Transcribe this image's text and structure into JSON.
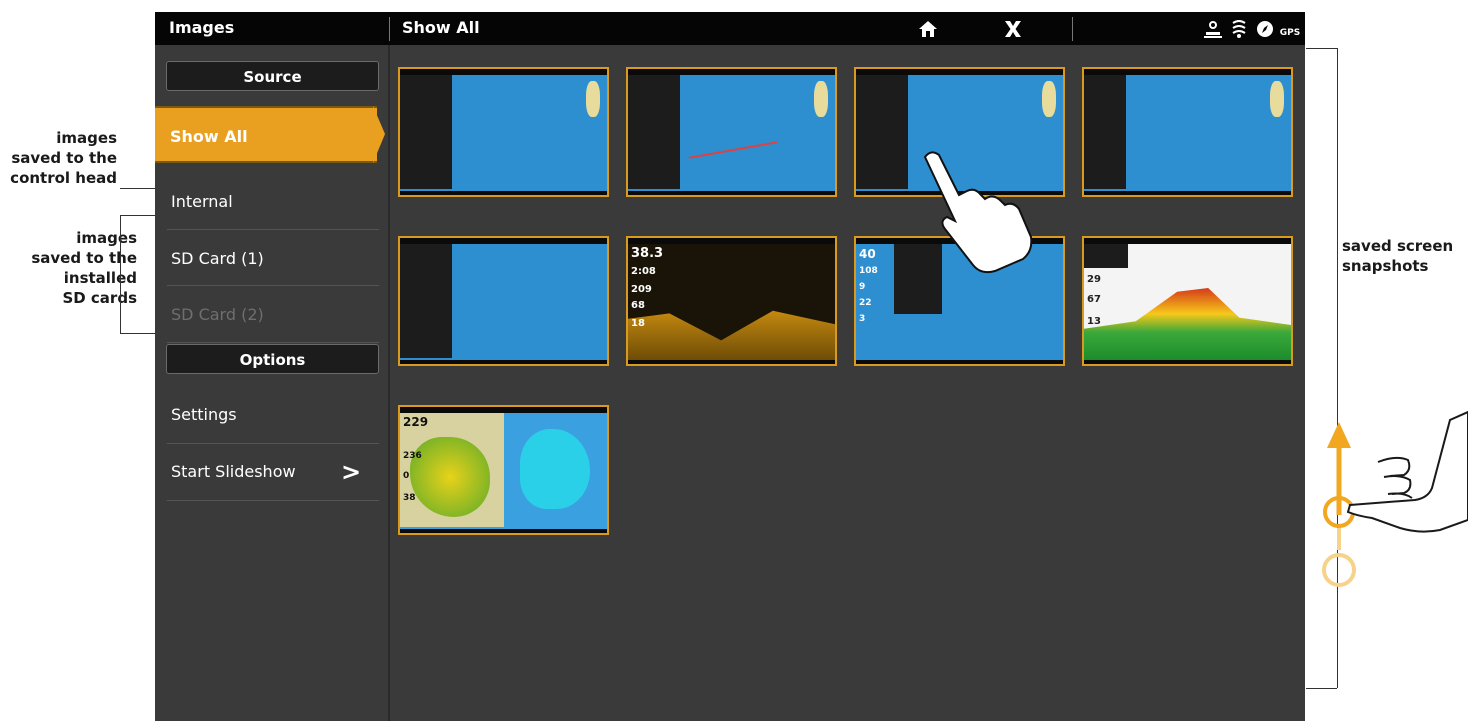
{
  "callouts": {
    "control_head": [
      "images",
      "saved to the",
      "control head"
    ],
    "sd_cards": [
      "images",
      "saved to the",
      "installed",
      "SD cards"
    ],
    "snapshots": [
      "saved screen",
      "snapshots"
    ]
  },
  "topbar": {
    "left_title": "Images",
    "right_title": "Show All",
    "icons": [
      "home-icon",
      "close-icon",
      "anchor-icon",
      "sonar-icon",
      "compass-icon",
      "gps-icon"
    ],
    "gps_label": "GPS"
  },
  "sidebar": {
    "source_header": "Source",
    "items": [
      {
        "label": "Show All",
        "selected": true
      },
      {
        "label": "Internal",
        "selected": false
      },
      {
        "label": "SD Card (1)",
        "selected": false
      },
      {
        "label": "SD Card (2)",
        "selected": false,
        "disabled": true
      }
    ],
    "options_header": "Options",
    "options": [
      {
        "label": "Settings"
      },
      {
        "label": "Start Slideshow",
        "arrow": ">"
      }
    ]
  },
  "thumbnails": [
    {
      "kind": "map-with-menu"
    },
    {
      "kind": "map-with-menu"
    },
    {
      "kind": "map-with-menu"
    },
    {
      "kind": "map-with-menu"
    },
    {
      "kind": "map-with-menu"
    },
    {
      "kind": "sonar",
      "readouts": [
        "38.3",
        "2:08",
        "209",
        "68",
        "18"
      ]
    },
    {
      "kind": "map-with-menu",
      "readouts": [
        "40",
        "108",
        "9",
        "22",
        "3"
      ]
    },
    {
      "kind": "color-sonar",
      "readouts": [
        "29",
        "67",
        "13"
      ]
    },
    {
      "kind": "split-map",
      "readouts": [
        "229",
        "236",
        "0",
        "38"
      ]
    }
  ],
  "colors": {
    "accent": "#e9a020",
    "screen_bg": "#3a3a3a",
    "topbar_bg": "#050505",
    "map_water": "#2e8fd0"
  }
}
